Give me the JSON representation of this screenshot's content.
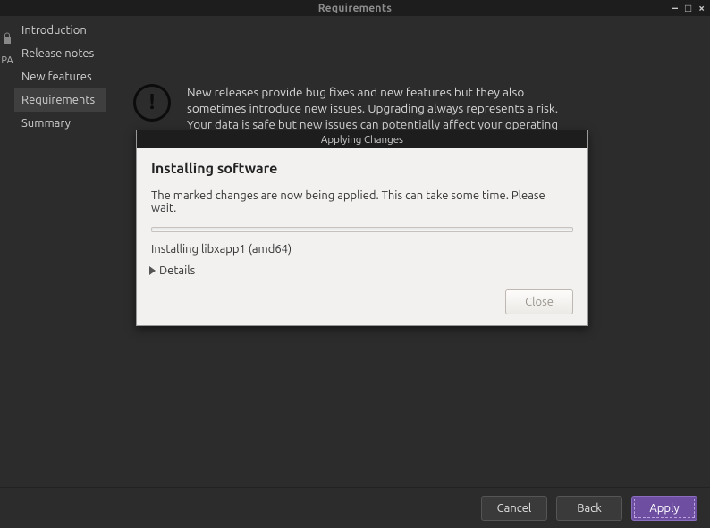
{
  "window": {
    "title": "Requirements"
  },
  "sidebar": {
    "lock_label": "PA",
    "items": [
      {
        "label": "Introduction",
        "selected": false
      },
      {
        "label": "Release notes",
        "selected": false
      },
      {
        "label": "New features",
        "selected": false
      },
      {
        "label": "Requirements",
        "selected": true
      },
      {
        "label": "Summary",
        "selected": false
      }
    ]
  },
  "info": {
    "text": "New releases provide bug fixes and new features but they also sometimes introduce new issues. Upgrading always represents a risk. Your data is safe but new issues can potentially affect your operating system."
  },
  "footer": {
    "cancel": "Cancel",
    "back": "Back",
    "apply": "Apply"
  },
  "modal": {
    "title": "Applying Changes",
    "heading": "Installing software",
    "message": "The marked changes are now being applied. This can take some time. Please wait.",
    "status": "Installing libxapp1 (amd64)",
    "details_label": "Details",
    "close": "Close"
  }
}
